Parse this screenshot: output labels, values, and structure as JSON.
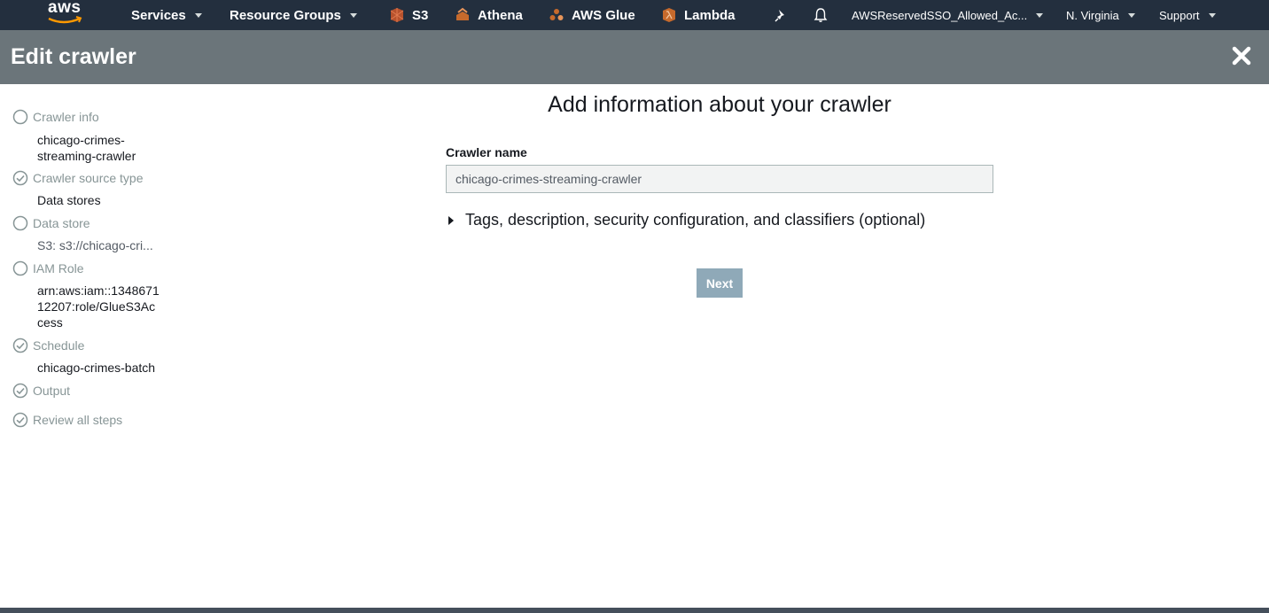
{
  "topnav": {
    "logo": "aws",
    "services": "Services",
    "resource_groups": "Resource Groups",
    "shortcuts": [
      {
        "label": "S3",
        "icon": "s3-icon"
      },
      {
        "label": "Athena",
        "icon": "athena-icon"
      },
      {
        "label": "AWS Glue",
        "icon": "glue-icon"
      },
      {
        "label": "Lambda",
        "icon": "lambda-icon"
      }
    ],
    "account": "AWSReservedSSO_Allowed_Ac...",
    "region": "N. Virginia",
    "support": "Support"
  },
  "header": {
    "title": "Edit crawler"
  },
  "steps": [
    {
      "label": "Crawler info",
      "value": "chicago-crimes-streaming-crawler",
      "completed": false
    },
    {
      "label": "Crawler source type",
      "value": "Data stores",
      "completed": true
    },
    {
      "label": "Data store",
      "value": "S3: s3://chicago-cri...",
      "completed": false
    },
    {
      "label": "IAM Role",
      "value": "arn:aws:iam::134867112207:role/GlueS3Access",
      "completed": false
    },
    {
      "label": "Schedule",
      "value": "chicago-crimes-batch",
      "completed": true
    },
    {
      "label": "Output",
      "value": "",
      "completed": true
    },
    {
      "label": "Review all steps",
      "value": "",
      "completed": true
    }
  ],
  "main": {
    "title": "Add information about your crawler",
    "crawler_name_label": "Crawler name",
    "crawler_name_value": "chicago-crimes-streaming-crawler",
    "optional_section": "Tags, description, security configuration, and classifiers (optional)",
    "next_label": "Next"
  },
  "colors": {
    "nav_bg": "#232f3e",
    "header_bg": "#6b757a",
    "next_button": "#8fa9b8",
    "step_label": "#879596"
  }
}
